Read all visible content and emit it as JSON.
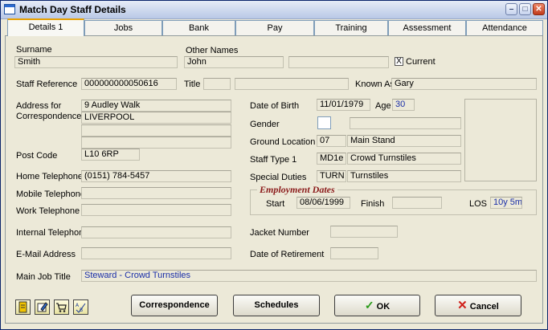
{
  "window": {
    "title": "Match Day Staff Details"
  },
  "tabs": [
    "Details 1",
    "Jobs",
    "Bank",
    "Pay",
    "Training",
    "Assessment",
    "Attendance"
  ],
  "surname": {
    "label": "Surname",
    "value": "Smith"
  },
  "other_names": {
    "label": "Other Names",
    "value": "John",
    "value2": ""
  },
  "current": {
    "label": "Current",
    "checked_mark": "X"
  },
  "staff_reference": {
    "label": "Staff Reference",
    "value": "000000000050616"
  },
  "title_field": {
    "label": "Title",
    "value": "",
    "value2": ""
  },
  "known_as": {
    "label": "Known As",
    "value": "Gary"
  },
  "address": {
    "label": "Address for Correspondence",
    "lines": [
      "9 Audley Walk",
      "LIVERPOOL",
      "",
      ""
    ]
  },
  "post_code": {
    "label": "Post Code",
    "value": "L10  6RP"
  },
  "home_telephone": {
    "label": "Home Telephone",
    "value": "(0151) 784-5457"
  },
  "mobile_telephone": {
    "label": "Mobile Telephone",
    "value": ""
  },
  "work_telephone": {
    "label": "Work Telephone",
    "value": ""
  },
  "internal_telephone": {
    "label": "Internal Telephone",
    "value": ""
  },
  "email": {
    "label": "E-Mail Address",
    "value": ""
  },
  "main_job_title": {
    "label": "Main Job Title",
    "value": "Steward - Crowd Turnstiles"
  },
  "date_of_birth": {
    "label": "Date of Birth",
    "value": "11/01/1979"
  },
  "age": {
    "label": "Age",
    "value": "30"
  },
  "gender": {
    "label": "Gender",
    "value": "",
    "desc": ""
  },
  "ground_location": {
    "label": "Ground Location",
    "code": "07",
    "desc": "Main Stand"
  },
  "staff_type": {
    "label": "Staff Type 1",
    "code": "MD1e",
    "desc": "Crowd Turnstiles"
  },
  "special_duties": {
    "label": "Special Duties",
    "code": "TURN",
    "desc": "Turnstiles"
  },
  "employment": {
    "legend": "Employment Dates",
    "start_label": "Start",
    "start": "08/06/1999",
    "finish_label": "Finish",
    "finish": "",
    "los_label": "LOS",
    "los": "10y 5m"
  },
  "jacket_number": {
    "label": "Jacket Number",
    "value": ""
  },
  "date_of_retirement": {
    "label": "Date of Retirement",
    "value": ""
  },
  "buttons": {
    "correspondence": "Correspondence",
    "schedules": "Schedules",
    "ok": "OK",
    "cancel": "Cancel"
  }
}
